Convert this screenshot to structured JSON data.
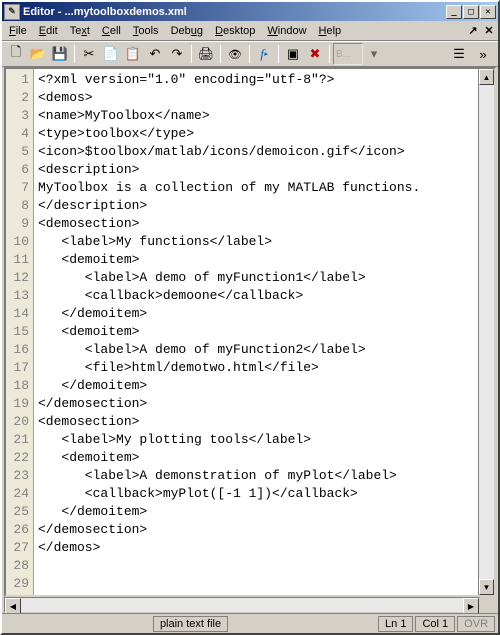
{
  "window": {
    "title": "Editor - ...mytoolboxdemos.xml"
  },
  "menu": {
    "file": "File",
    "edit": "Edit",
    "text": "Text",
    "cell": "Cell",
    "tools": "Tools",
    "debug": "Debug",
    "desktop": "Desktop",
    "window": "Window",
    "help": "Help"
  },
  "toolbar": {
    "base_label": "B..."
  },
  "code": {
    "lines": [
      "<?xml version=\"1.0\" encoding=\"utf-8\"?>",
      "<demos>",
      "",
      "<name>MyToolbox</name>",
      "<type>toolbox</type>",
      "<icon>$toolbox/matlab/icons/demoicon.gif</icon>",
      "<description>",
      "MyToolbox is a collection of my MATLAB functions.",
      "</description>",
      "",
      "<demosection>",
      "   <label>My functions</label>",
      "   <demoitem>",
      "      <label>A demo of myFunction1</label>",
      "      <callback>demoone</callback>",
      "   </demoitem>",
      "   <demoitem>",
      "      <label>A demo of myFunction2</label>",
      "      <file>html/demotwo.html</file>",
      "   </demoitem>",
      "</demosection>",
      "",
      "<demosection>",
      "   <label>My plotting tools</label>",
      "   <demoitem>",
      "      <label>A demonstration of myPlot</label>",
      "      <callback>myPlot([-1 1])</callback>",
      "   </demoitem>",
      "</demosection>",
      "",
      "</demos>"
    ]
  },
  "status": {
    "filetype": "plain text file",
    "line_label": "Ln",
    "line": "1",
    "col_label": "Col",
    "col": "1",
    "ovr": "OVR"
  }
}
